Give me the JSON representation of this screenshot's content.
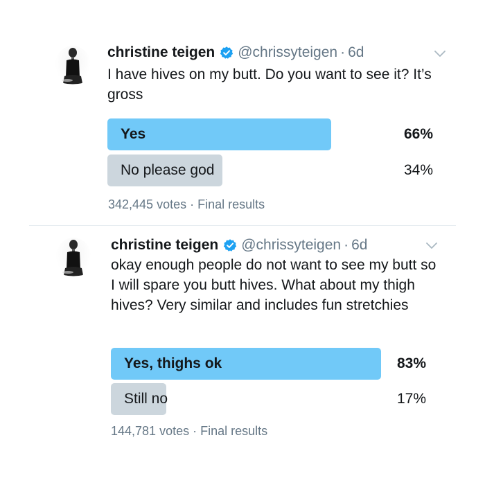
{
  "tweets": [
    {
      "author": {
        "name": "christine teigen",
        "handle": "@chrissyteigen",
        "age": "6d"
      },
      "separator": "·",
      "text": "I have hives on my butt. Do you want to see it? It’s gross",
      "poll": {
        "options": [
          {
            "label": "Yes",
            "percent": "66%",
            "share": 0.66,
            "winner": true
          },
          {
            "label": "No please god",
            "percent": "34%",
            "share": 0.34,
            "winner": false
          }
        ],
        "votes": "342,445 votes",
        "status": "Final results"
      }
    },
    {
      "author": {
        "name": "christine teigen",
        "handle": "@chrissyteigen",
        "age": "6d"
      },
      "separator": "·",
      "text": "okay enough people do not want to see my butt so I will spare you butt hives. What about my thigh hives? Very similar and includes fun stretchies",
      "poll": {
        "options": [
          {
            "label": "Yes, thighs ok",
            "percent": "83%",
            "share": 0.83,
            "winner": true
          },
          {
            "label": "Still no",
            "percent": "17%",
            "share": 0.17,
            "winner": false
          }
        ],
        "votes": "144,781 votes",
        "status": "Final results"
      }
    }
  ],
  "colors": {
    "winner_bar": "#71c9f8",
    "loser_bar": "#ccd6dd",
    "verified_badge": "#1da1f2",
    "secondary_text": "#657786"
  },
  "icons": {
    "verified": "verified-badge-icon",
    "menu": "chevron-down-icon",
    "avatar": "profile-photo"
  }
}
